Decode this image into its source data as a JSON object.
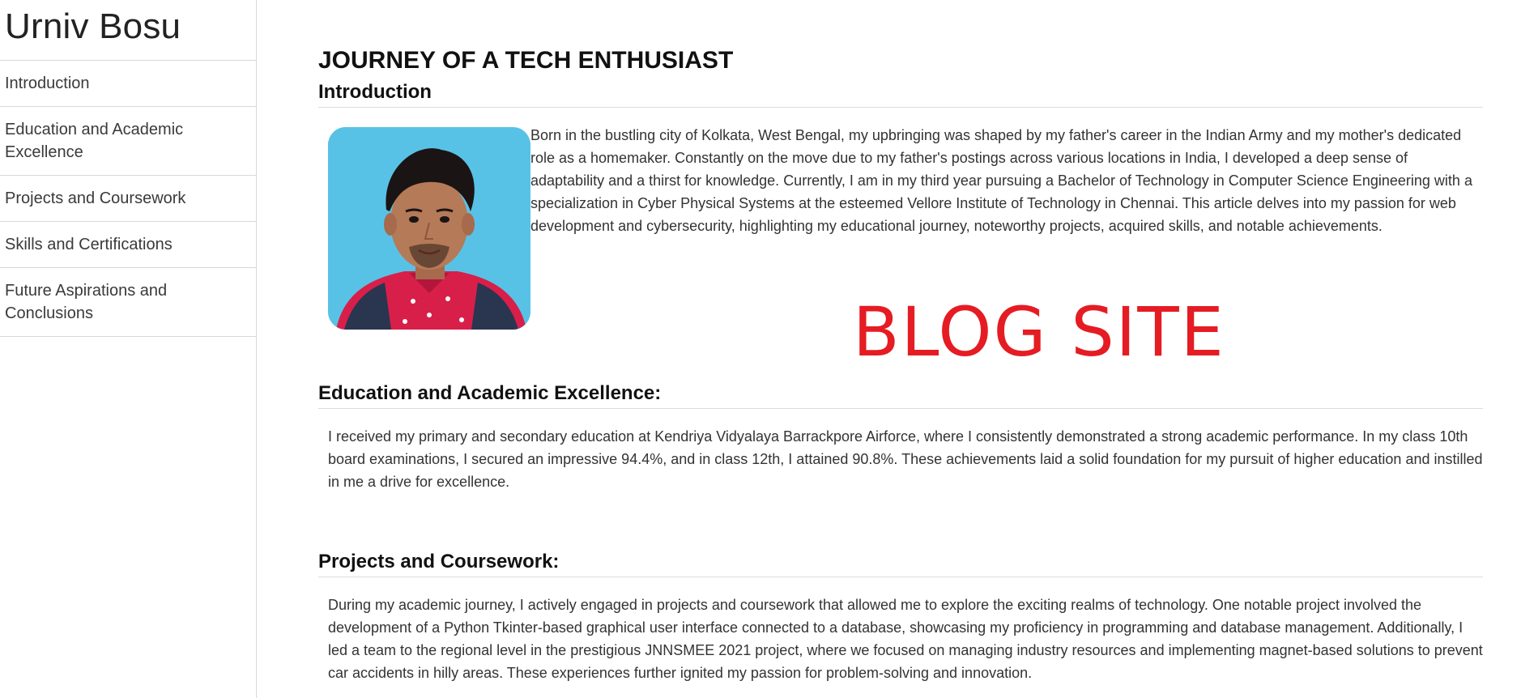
{
  "sidebar": {
    "site_title": "Urniv Bosu",
    "items": [
      {
        "label": "Introduction"
      },
      {
        "label": "Education and Academic Excellence"
      },
      {
        "label": "Projects and Coursework"
      },
      {
        "label": "Skills and Certifications"
      },
      {
        "label": "Future Aspirations and Conclusions"
      }
    ]
  },
  "main": {
    "page_heading": "JOURNEY OF A TECH ENTHUSIAST",
    "introduction": {
      "heading": "Introduction",
      "text": "Born in the bustling city of Kolkata, West Bengal, my upbringing was shaped by my father's career in the Indian Army and my mother's dedicated role as a homemaker. Constantly on the move due to my father's postings across various locations in India, I developed a deep sense of adaptability and a thirst for knowledge. Currently, I am in my third year pursuing a Bachelor of Technology in Computer Science Engineering with a specialization in Cyber Physical Systems at the esteemed Vellore Institute of Technology in Chennai. This article delves into my passion for web development and cybersecurity, highlighting my educational journey, noteworthy projects, acquired skills, and notable achievements."
    },
    "stamp_text": "BLOG SITE",
    "education": {
      "heading": "Education and Academic Excellence:",
      "text": "I received my primary and secondary education at Kendriya Vidyalaya Barrackpore Airforce, where I consistently demonstrated a strong academic performance. In my class 10th board examinations, I secured an impressive 94.4%, and in class 12th, I attained 90.8%. These achievements laid a solid foundation for my pursuit of higher education and instilled in me a drive for excellence."
    },
    "projects": {
      "heading": "Projects and Coursework:",
      "text": "During my academic journey, I actively engaged in projects and coursework that allowed me to explore the exciting realms of technology. One notable project involved the development of a Python Tkinter-based graphical user interface connected to a database, showcasing my proficiency in programming and database management. Additionally, I led a team to the regional level in the prestigious JNNSMEE 2021 project, where we focused on managing industry resources and implementing magnet-based solutions to prevent car accidents in hilly areas. These experiences further ignited my passion for problem-solving and innovation."
    }
  },
  "colors": {
    "stamp": "#e51c23",
    "portrait_background": "#58c2e6",
    "shirt": "#d81f4a",
    "divider": "#d8d8d8"
  }
}
